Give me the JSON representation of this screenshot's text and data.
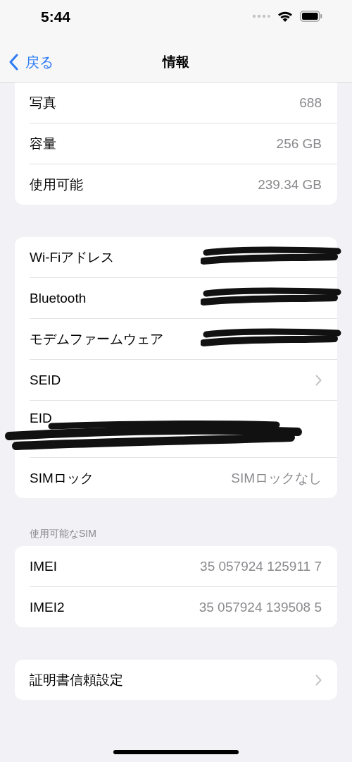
{
  "status_bar": {
    "time": "5:44"
  },
  "nav": {
    "back": "戻る",
    "title": "情報"
  },
  "groups": [
    {
      "rows": [
        {
          "kind": "value",
          "label": "写真",
          "value": "688"
        },
        {
          "kind": "value",
          "label": "容量",
          "value": "256 GB"
        },
        {
          "kind": "value",
          "label": "使用可能",
          "value": "239.34 GB"
        }
      ]
    },
    {
      "rows": [
        {
          "kind": "hidden",
          "label": "Wi-Fiアドレス"
        },
        {
          "kind": "hidden",
          "label": "Bluetooth"
        },
        {
          "kind": "hidden",
          "label": "モデムファームウェア"
        },
        {
          "kind": "link",
          "label": "SEID"
        },
        {
          "kind": "hidden-below",
          "label": "EID"
        },
        {
          "kind": "value",
          "label": "SIMロック",
          "value": "SIMロックなし"
        }
      ]
    },
    {
      "header": "使用可能なSIM",
      "rows": [
        {
          "kind": "value",
          "label": "IMEI",
          "value": "35 057924 125911 7"
        },
        {
          "kind": "value",
          "label": "IMEI2",
          "value": "35 057924 139508 5"
        }
      ]
    },
    {
      "rows": [
        {
          "kind": "link",
          "label": "証明書信頼設定"
        }
      ]
    }
  ]
}
